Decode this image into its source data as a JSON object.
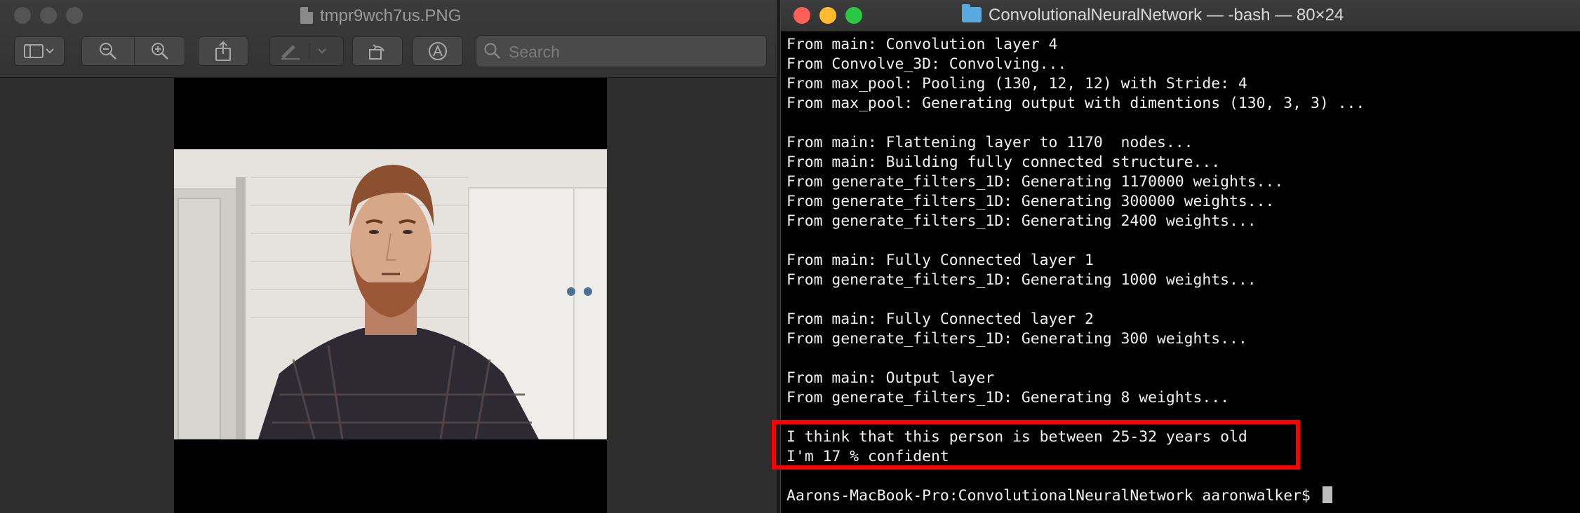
{
  "preview": {
    "title": "tmpr9wch7us.PNG",
    "toolbar": {
      "search_placeholder": "Search",
      "sidebar_icon": "sidebar-icon",
      "zoom_out_icon": "zoom-out-icon",
      "zoom_in_icon": "zoom-in-icon",
      "share_icon": "share-icon",
      "markup_icon": "markup-pen-icon",
      "rotate_icon": "rotate-icon",
      "annotate_icon": "annotate-icon"
    }
  },
  "terminal": {
    "title": "ConvolutionalNeuralNetwork — -bash — 80×24",
    "lines": [
      "From main: Convolution layer 4",
      "From Convolve_3D: Convolving...",
      "From max_pool: Pooling (130, 12, 12) with Stride: 4",
      "From max_pool: Generating output with dimentions (130, 3, 3) ...",
      "",
      "From main: Flattening layer to 1170  nodes...",
      "From main: Building fully connected structure...",
      "From generate_filters_1D: Generating 1170000 weights...",
      "From generate_filters_1D: Generating 300000 weights...",
      "From generate_filters_1D: Generating 2400 weights...",
      "",
      "From main: Fully Connected layer 1",
      "From generate_filters_1D: Generating 1000 weights...",
      "",
      "From main: Fully Connected layer 2",
      "From generate_filters_1D: Generating 300 weights...",
      "",
      "From main: Output layer",
      "From generate_filters_1D: Generating 8 weights...",
      "",
      "I think that this person is between 25-32 years old",
      "I'm 17 % confident",
      ""
    ],
    "prompt": "Aarons-MacBook-Pro:ConvolutionalNeuralNetwork aaronwalker$ ",
    "highlight_color": "#ff0000",
    "traffic_colors": [
      "#fe5f57",
      "#febc2e",
      "#28c840"
    ]
  }
}
